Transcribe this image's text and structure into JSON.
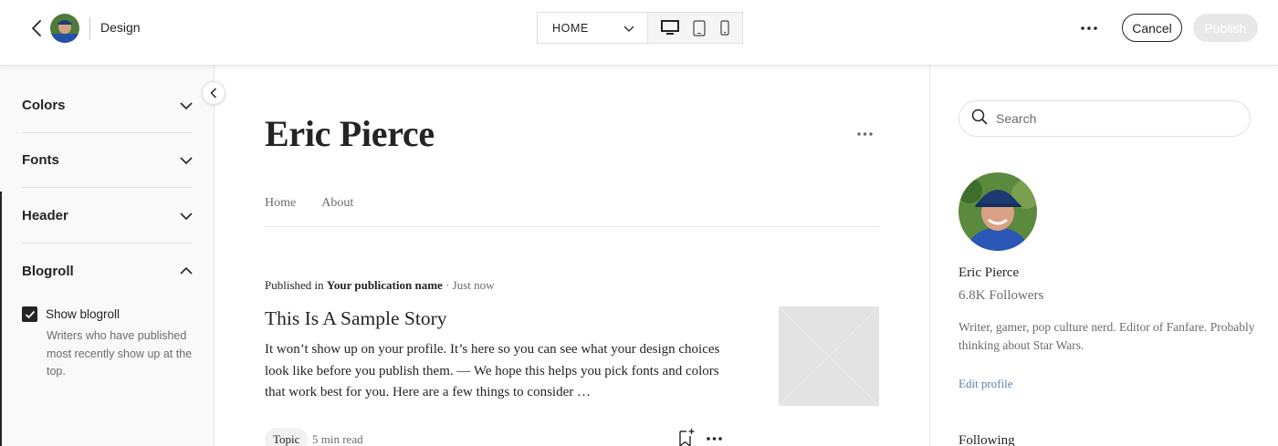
{
  "topbar": {
    "design_label": "Design",
    "page_select": {
      "selected": "HOME"
    },
    "actions": {
      "cancel": "Cancel",
      "publish": "Publish"
    },
    "device_icons": [
      "desktop-icon",
      "tablet-icon",
      "mobile-icon"
    ],
    "selected_device": "desktop"
  },
  "sidebar": {
    "sections": [
      {
        "label": "Colors",
        "expanded": false
      },
      {
        "label": "Fonts",
        "expanded": false
      },
      {
        "label": "Header",
        "expanded": false
      },
      {
        "label": "Blogroll",
        "expanded": true
      }
    ],
    "blogroll": {
      "checkbox_label": "Show blogroll",
      "checked": true,
      "help_text": "Writers who have published most recently show up at the top."
    }
  },
  "main": {
    "site_title": "Eric Pierce",
    "nav": [
      "Home",
      "About"
    ],
    "story": {
      "published_in_prefix": "Published in",
      "publication": "Your publication name",
      "time": "· Just now",
      "title": "This Is A Sample Story",
      "excerpt": "It won’t show up on your profile. It’s here so you can see what your design choices look like before you publish them. — We hope this helps you pick fonts and colors that work best for you. Here are a few things to consider …",
      "topic": "Topic",
      "read_time": "5 min read"
    }
  },
  "right": {
    "search_placeholder": "Search",
    "author_name": "Eric Pierce",
    "followers": "6.8K Followers",
    "bio": "Writer, gamer, pop culture nerd. Editor of Fanfare. Probably thinking about Star Wars.",
    "edit_profile": "Edit profile",
    "following_heading": "Following"
  },
  "colors": {
    "text": "#242424",
    "muted": "#6b6b6b",
    "link": "#5a7fa8",
    "publish_disabled": "#e8e8e8",
    "sidebar_bg": "#f9f9f9"
  }
}
